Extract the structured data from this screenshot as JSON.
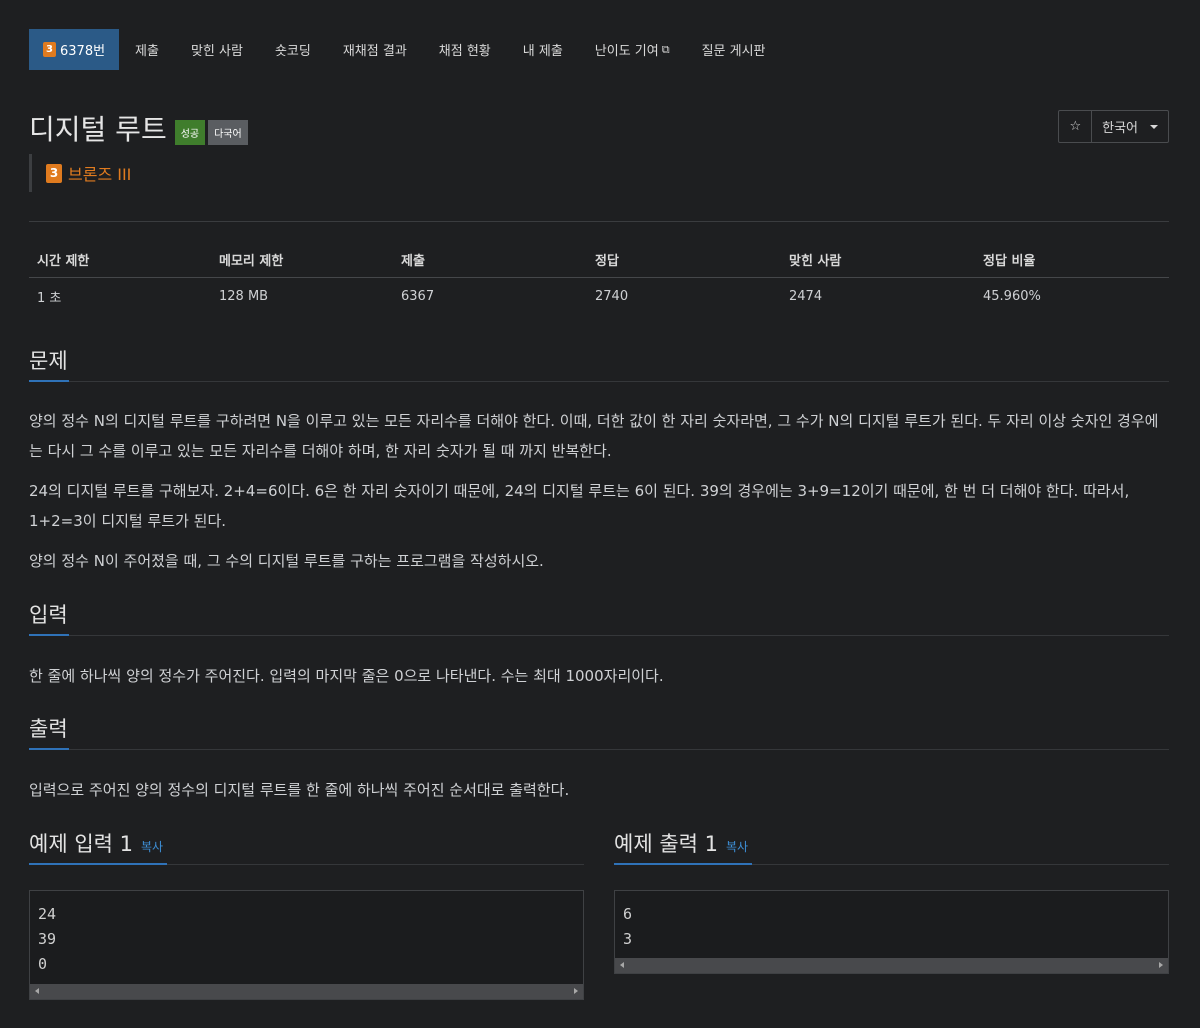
{
  "tabs": {
    "problem_no": "6378번",
    "tier_number": "3",
    "items": [
      "제출",
      "맞힌 사람",
      "숏코딩",
      "재채점 결과",
      "채점 현황",
      "내 제출",
      "난이도 기여",
      "질문 게시판"
    ]
  },
  "problem": {
    "title": "디지털 루트",
    "label_success": "성공",
    "label_multilang": "다국어",
    "tier_number": "3",
    "tier_label": "브론즈 III",
    "star": "☆",
    "language": "한국어"
  },
  "info": {
    "headers": [
      "시간 제한",
      "메모리 제한",
      "제출",
      "정답",
      "맞힌 사람",
      "정답 비율"
    ],
    "values": [
      "1 초",
      "128 MB",
      "6367",
      "2740",
      "2474",
      "45.960%"
    ]
  },
  "sections": {
    "description_title": "문제",
    "description": [
      "양의 정수 N의 디지털 루트를 구하려면 N을 이루고 있는 모든 자리수를 더해야 한다. 이때, 더한 값이 한 자리 숫자라면, 그 수가 N의 디지털 루트가 된다. 두 자리 이상 숫자인 경우에는 다시 그 수를 이루고 있는 모든 자리수를 더해야 하며, 한 자리 숫자가 될 때 까지 반복한다.",
      "24의 디지털 루트를 구해보자. 2+4=6이다. 6은 한 자리 숫자이기 때문에, 24의 디지털 루트는 6이 된다. 39의 경우에는 3+9=12이기 때문에, 한 번 더 더해야 한다. 따라서, 1+2=3이 디지털 루트가 된다.",
      "양의 정수 N이 주어졌을 때, 그 수의 디지털 루트를 구하는 프로그램을 작성하시오."
    ],
    "input_title": "입력",
    "input": "한 줄에 하나씩 양의 정수가 주어진다. 입력의 마지막 줄은 0으로 나타낸다.  수는 최대 1000자리이다.",
    "output_title": "출력",
    "output": "입력으로 주어진 양의 정수의 디지털 루트를 한 줄에 하나씩 주어진 순서대로 출력한다."
  },
  "samples": {
    "input_title": "예제 입력 1",
    "output_title": "예제 출력 1",
    "copy_label": "복사",
    "input_text": "24\n39\n0",
    "output_text": "6\n3"
  }
}
